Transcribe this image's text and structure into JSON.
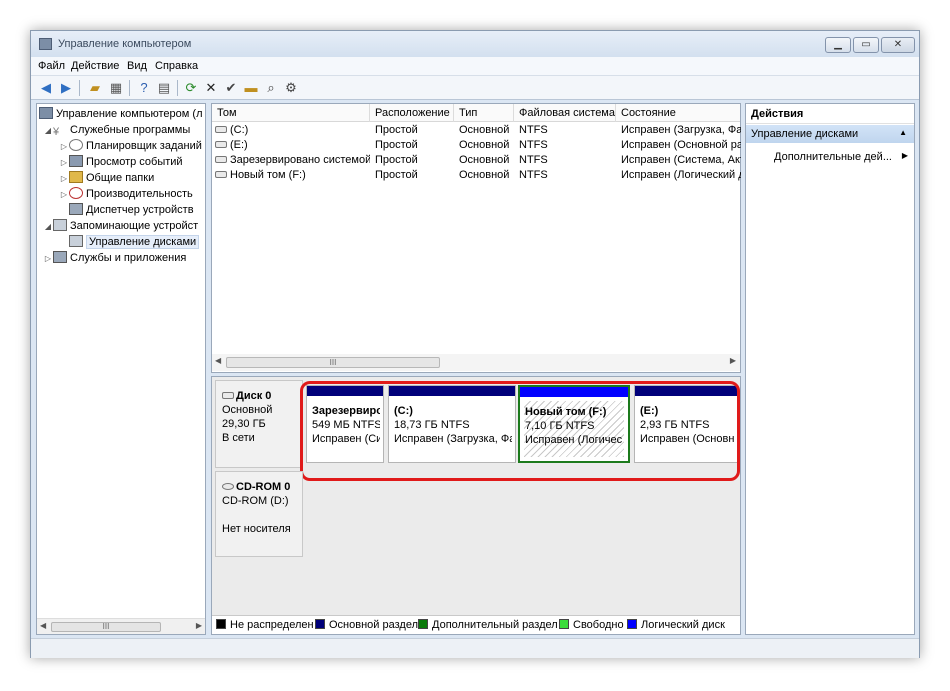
{
  "window": {
    "title": "Управление компьютером"
  },
  "menu": [
    "Файл",
    "Действие",
    "Вид",
    "Справка"
  ],
  "toolbar": {
    "icons": [
      "back-arrow-icon",
      "forward-arrow-icon",
      "up-folder-icon",
      "show-hide-tree-icon",
      "help-icon",
      "properties-icon",
      "refresh-icon",
      "delete-icon",
      "check-icon",
      "folder-open-icon",
      "search-icon",
      "settings-icon"
    ]
  },
  "tree": {
    "items": [
      {
        "label": "Управление компьютером (л",
        "level": 0,
        "expander": ""
      },
      {
        "label": "Служебные программы",
        "level": 1,
        "expander": "◢"
      },
      {
        "label": "Планировщик заданий",
        "level": 2,
        "expander": "▷"
      },
      {
        "label": "Просмотр событий",
        "level": 2,
        "expander": "▷"
      },
      {
        "label": "Общие папки",
        "level": 2,
        "expander": "▷"
      },
      {
        "label": "Производительность",
        "level": 2,
        "expander": "▷"
      },
      {
        "label": "Диспетчер устройств",
        "level": 2,
        "expander": ""
      },
      {
        "label": "Запоминающие устройст",
        "level": 1,
        "expander": "◢"
      },
      {
        "label": "Управление дисками",
        "level": 2,
        "expander": ""
      },
      {
        "label": "Службы и приложения",
        "level": 1,
        "expander": "▷"
      }
    ],
    "scroll_thumb": "III"
  },
  "volumes": {
    "columns": [
      "Том",
      "Расположение",
      "Тип",
      "Файловая система",
      "Состояние"
    ],
    "rows": [
      [
        "(C:)",
        "Простой",
        "Основной",
        "NTFS",
        "Исправен (Загрузка, Фай"
      ],
      [
        "(E:)",
        "Простой",
        "Основной",
        "NTFS",
        "Исправен (Основной ра:"
      ],
      [
        "Зарезервировано системой",
        "Простой",
        "Основной",
        "NTFS",
        "Исправен (Система, Акти"
      ],
      [
        "Новый том (F:)",
        "Простой",
        "Основной",
        "NTFS",
        "Исправен (Логический д"
      ]
    ],
    "scroll_thumb": "III"
  },
  "disks": [
    {
      "name": "Диск 0",
      "kind": "Основной",
      "size": "29,30 ГБ",
      "status": "В сети",
      "partitions": [
        {
          "title": "Зарезервиро",
          "size": "549 МБ NTFS",
          "state": "Исправен (Си",
          "color": "#00007a"
        },
        {
          "title": "(C:)",
          "size": "18,73 ГБ NTFS",
          "state": "Исправен (Загрузка, Фа",
          "color": "#00007a"
        },
        {
          "title": "Новый том  (F:)",
          "size": "7,10 ГБ NTFS",
          "state": "Исправен (Логичес",
          "color": "#0000ff"
        },
        {
          "title": "(E:)",
          "size": "2,93 ГБ NTFS",
          "state": "Исправен (Основн",
          "color": "#00007a"
        }
      ]
    },
    {
      "name": "CD-ROM 0",
      "kind": "CD-ROM (D:)",
      "media": "Нет носителя"
    }
  ],
  "legend": [
    {
      "label": "Не распределен",
      "color": "#000000"
    },
    {
      "label": "Основной раздел",
      "color": "#00007a"
    },
    {
      "label": "Дополнительный раздел",
      "color": "#0a7a0a"
    },
    {
      "label": "Свободно",
      "color": "#3cdc3c"
    },
    {
      "label": "Логический диск",
      "color": "#0000ff"
    }
  ],
  "actions": {
    "header": "Действия",
    "section": "Управление дисками",
    "item": "Дополнительные дей..."
  }
}
